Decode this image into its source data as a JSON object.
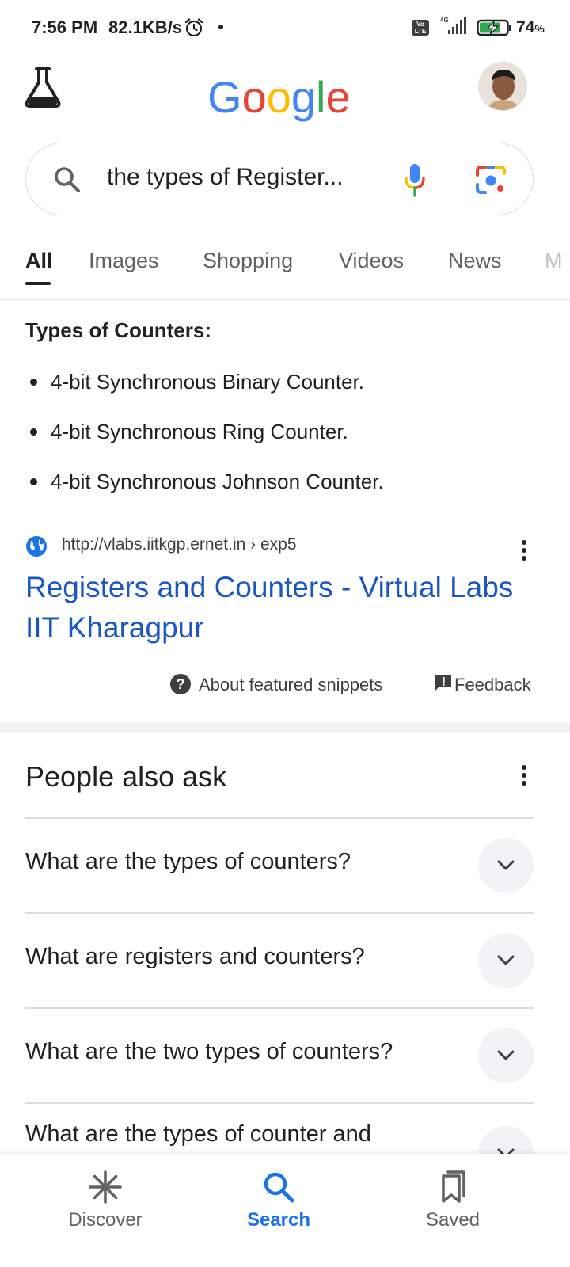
{
  "status_bar": {
    "time": "7:56 PM",
    "speed": "82.1KB/s",
    "volte": "Vo LTE",
    "network": "4G",
    "battery_value": "74",
    "battery_unit": "%"
  },
  "header": {
    "logo_text": "Google",
    "labs_icon": "flask-icon",
    "avatar_icon": "profile-avatar"
  },
  "search": {
    "query": "the types of Register..."
  },
  "tabs": [
    {
      "label": "All",
      "active": true
    },
    {
      "label": "Images"
    },
    {
      "label": "Shopping"
    },
    {
      "label": "Videos"
    },
    {
      "label": "News"
    },
    {
      "label": "M"
    }
  ],
  "snippet": {
    "heading": "Types of Counters:",
    "items": [
      "4-bit Synchronous Binary Counter.",
      "4-bit Synchronous Ring Counter.",
      "4-bit Synchronous Johnson Counter."
    ],
    "source_url": "http://vlabs.iitkgp.ernet.in › exp5",
    "title": "Registers and Counters - Virtual Labs IIT Kharagpur",
    "about_label": "About featured snippets",
    "feedback_label": "Feedback"
  },
  "people_also_ask": {
    "title": "People also ask",
    "questions": [
      "What are the types of counters?",
      "What are registers and counters?",
      "What are the two types of counters?",
      "What are the types of counter and"
    ]
  },
  "bottom_nav": [
    {
      "label": "Discover",
      "icon": "discover-icon"
    },
    {
      "label": "Search",
      "icon": "search-icon",
      "active": true
    },
    {
      "label": "Saved",
      "icon": "saved-icon"
    }
  ],
  "colors": {
    "link_blue": "#1a56c4",
    "accent_blue": "#1a73e8",
    "text": "#202124",
    "muted": "#5f6368"
  }
}
